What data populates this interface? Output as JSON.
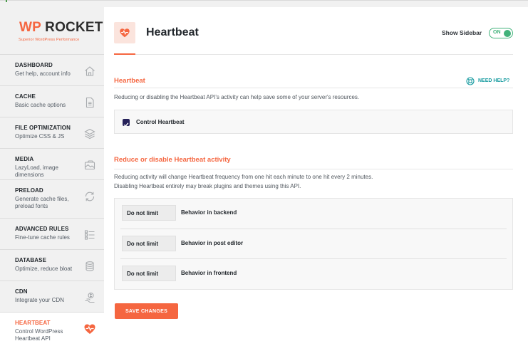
{
  "brand": {
    "name_accent": "WP",
    "name_rest": " ROCKET",
    "tagline": "Superior WordPress Performance",
    "accent_color": "#f56640"
  },
  "nav": [
    {
      "title": "DASHBOARD",
      "desc": "Get help, account info",
      "icon": "home-icon"
    },
    {
      "title": "CACHE",
      "desc": "Basic cache options",
      "icon": "file-icon"
    },
    {
      "title": "FILE OPTIMIZATION",
      "desc": "Optimize CSS & JS",
      "icon": "layers-icon"
    },
    {
      "title": "MEDIA",
      "desc": "LazyLoad, image dimensions",
      "icon": "image-icon"
    },
    {
      "title": "PRELOAD",
      "desc": "Generate cache files, preload fonts",
      "icon": "refresh-icon"
    },
    {
      "title": "ADVANCED RULES",
      "desc": "Fine-tune cache rules",
      "icon": "list-icon"
    },
    {
      "title": "DATABASE",
      "desc": "Optimize, reduce bloat",
      "icon": "database-icon"
    },
    {
      "title": "CDN",
      "desc": "Integrate your CDN",
      "icon": "cdn-icon"
    },
    {
      "title": "HEARTBEAT",
      "desc": "Control WordPress Heartbeat API",
      "icon": "heartbeat-icon",
      "active": true
    }
  ],
  "header": {
    "title": "Heartbeat",
    "show_sidebar_label": "Show Sidebar",
    "toggle_state": "ON"
  },
  "section1": {
    "title": "Heartbeat",
    "help_label": "NEED HELP?",
    "description": "Reducing or disabling the Heartbeat API's activity can help save some of your server's resources.",
    "checkbox_label": "Control Heartbeat",
    "checked": true
  },
  "section2": {
    "title": "Reduce or disable Heartbeat activity",
    "description_line1": "Reducing activity will change Heartbeat frequency from one hit each minute to one hit every 2 minutes.",
    "description_line2": "Disabling Heartbeat entirely may break plugins and themes using this API.",
    "rows": [
      {
        "value": "Do not limit",
        "label": "Behavior in backend"
      },
      {
        "value": "Do not limit",
        "label": "Behavior in post editor"
      },
      {
        "value": "Do not limit",
        "label": "Behavior in frontend"
      }
    ]
  },
  "save_label": "SAVE CHANGES"
}
